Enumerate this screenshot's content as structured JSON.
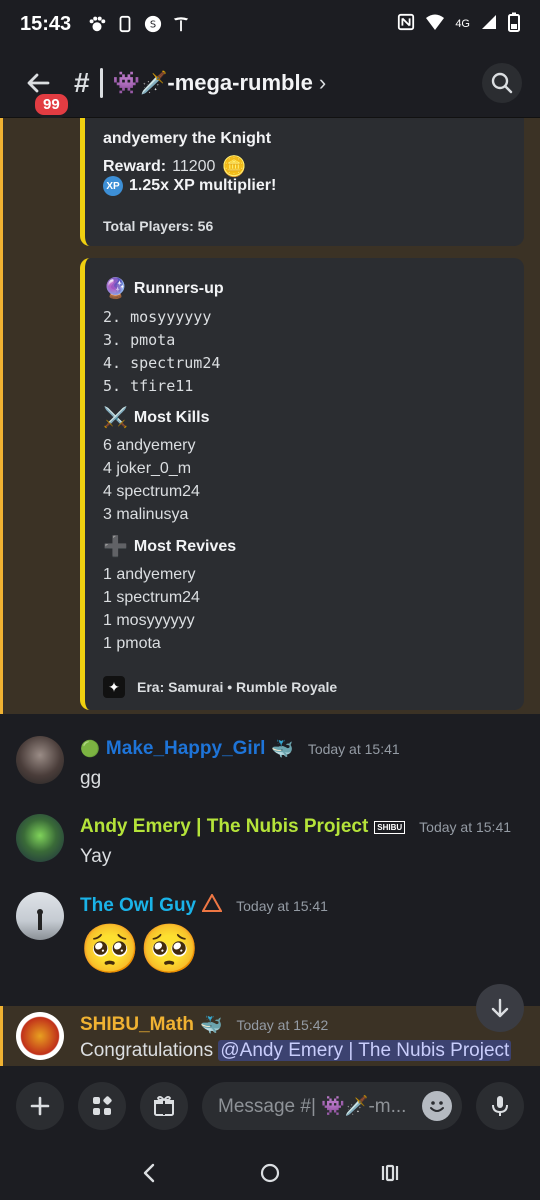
{
  "status_bar": {
    "time": "15:43",
    "network": "4G",
    "left_icons": [
      "paw-icon",
      "phone-icon",
      "shazam-icon",
      "tesla-icon"
    ],
    "right_icons": [
      "nfc-icon",
      "wifi-icon",
      "signal-icon",
      "battery-icon"
    ]
  },
  "header": {
    "back_badge": "99",
    "hash": "#",
    "channel_name": "👾🗡️-mega-rumble",
    "chevron": "›"
  },
  "embed_top": {
    "winner_line": "andyemery the Knight",
    "reward_label": "Reward:",
    "reward_value": "11200",
    "reward_emoji": "🪙",
    "xp_icon": "XP",
    "xp_text": "1.25x XP multiplier!",
    "total_players": "Total Players: 56"
  },
  "embed_stats": {
    "runners_up": {
      "emoji": "🔮",
      "title": "Runners-up",
      "items": [
        "2. mosyyyyyy",
        "3. pmota",
        "4. spectrum24",
        "5. tfire11"
      ]
    },
    "most_kills": {
      "emoji": "⚔️",
      "title": "Most Kills",
      "items": [
        "6 andyemery",
        "4 joker_0_m",
        "4 spectrum24",
        "3 malinusya"
      ]
    },
    "most_revives": {
      "emoji": "➕",
      "title": "Most Revives",
      "items": [
        "1 andyemery",
        "1 spectrum24",
        "1 mosyyyyyy",
        "1 pmota"
      ]
    },
    "footer": "Era: Samurai • Rumble Royale"
  },
  "messages": [
    {
      "username_prefix": "🟢",
      "username": "Make_Happy_Girl",
      "username_color": "#1e74d8",
      "badge": "🐳",
      "timestamp": "Today at 15:41",
      "text": "gg"
    },
    {
      "username": "Andy Emery | The Nubis Project",
      "username_color": "#b5e33a",
      "badge": "SHIBU",
      "timestamp": "Today at 15:41",
      "text": "Yay"
    },
    {
      "username": "The Owl Guy",
      "username_color": "#1ab3e8",
      "badge": "🔺",
      "timestamp": "Today at 15:41",
      "text": "🥺🥺"
    },
    {
      "username": "SHIBU_Math",
      "username_color": "#f0b232",
      "badge": "🐳",
      "timestamp": "Today at 15:42",
      "text_before": "Congratulations ",
      "mention": "@Andy Emery | The Nubis Project"
    }
  ],
  "composer": {
    "placeholder": "Message #| 👾🗡️-m..."
  },
  "colors": {
    "background": "#1c1d22",
    "embed_bg": "#2b2d31",
    "embed_accent": "#f0d010",
    "highlight_bg": "#3b3225",
    "highlight_bar": "#f0b232",
    "mention_bg": "#3c4270"
  }
}
